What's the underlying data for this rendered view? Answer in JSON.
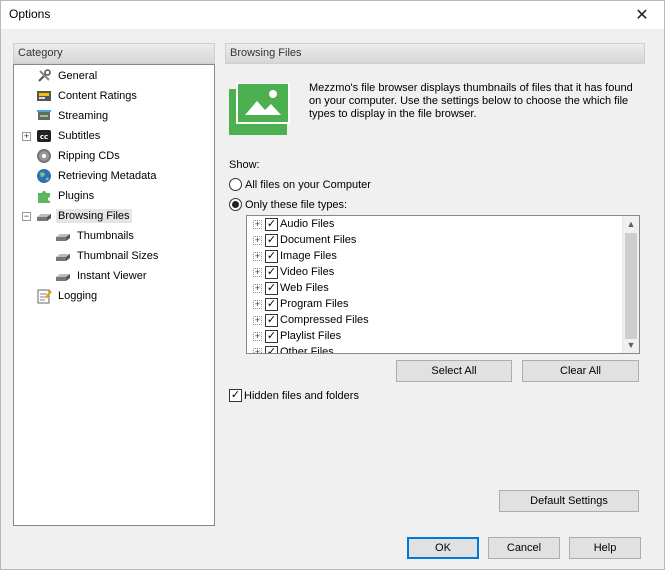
{
  "window": {
    "title": "Options",
    "close_glyph": "✕"
  },
  "category": {
    "header": "Category",
    "items": [
      {
        "label": "General",
        "icon": "tools-icon"
      },
      {
        "label": "Content Ratings",
        "icon": "rating-icon"
      },
      {
        "label": "Streaming",
        "icon": "streaming-icon"
      },
      {
        "label": "Subtitles",
        "icon": "cc-icon"
      },
      {
        "label": "Ripping CDs",
        "icon": "cd-icon"
      },
      {
        "label": "Retrieving Metadata",
        "icon": "globe-icon"
      },
      {
        "label": "Plugins",
        "icon": "puzzle-icon"
      },
      {
        "label": "Browsing Files",
        "icon": "drive-icon"
      },
      {
        "label": "Thumbnails",
        "icon": "drive-icon"
      },
      {
        "label": "Thumbnail Sizes",
        "icon": "drive-icon"
      },
      {
        "label": "Instant Viewer",
        "icon": "drive-icon"
      },
      {
        "label": "Logging",
        "icon": "log-icon"
      }
    ],
    "selected": "Browsing Files"
  },
  "panel": {
    "header": "Browsing Files",
    "description": "Mezzmo's file browser displays thumbnails of files that it has found on your computer.  Use the settings below to choose the which file types to display in the file browser.",
    "show_label": "Show:",
    "radio_all": "All files on your Computer",
    "radio_only": "Only these file types:",
    "selected_radio": "only",
    "file_types": [
      {
        "label": "Audio Files",
        "checked": true
      },
      {
        "label": "Document Files",
        "checked": true
      },
      {
        "label": "Image Files",
        "checked": true
      },
      {
        "label": "Video Files",
        "checked": true
      },
      {
        "label": "Web Files",
        "checked": true
      },
      {
        "label": "Program Files",
        "checked": true
      },
      {
        "label": "Compressed Files",
        "checked": true
      },
      {
        "label": "Playlist Files",
        "checked": true
      },
      {
        "label": "Other Files",
        "checked": true
      }
    ],
    "select_all": "Select All",
    "clear_all": "Clear All",
    "hidden_label": "Hidden files and folders",
    "hidden_checked": true,
    "default_settings": "Default Settings"
  },
  "footer": {
    "ok": "OK",
    "cancel": "Cancel",
    "help": "Help"
  },
  "colors": {
    "accent": "#0078d7",
    "icon_green": "#4caf50"
  }
}
